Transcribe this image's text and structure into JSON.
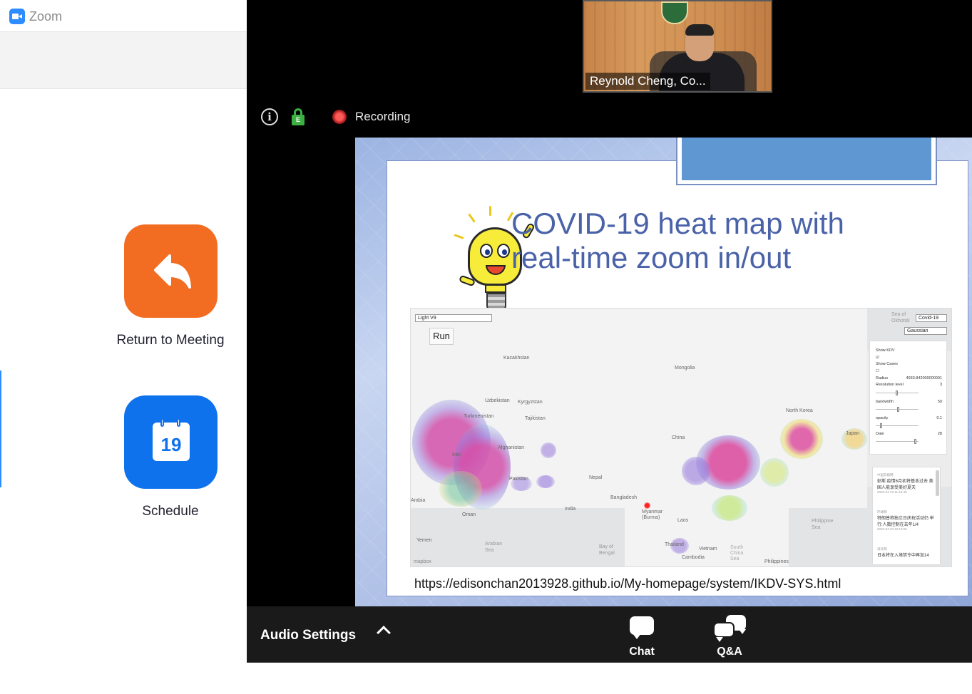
{
  "zoom_app": {
    "title": "Zoom",
    "home": {
      "return_label": "Return to Meeting",
      "schedule_label": "Schedule",
      "calendar_day": "19",
      "return_color": "#f26d21",
      "schedule_color": "#0e72ed"
    }
  },
  "meeting": {
    "participant": {
      "name": "Reynold Cheng, Co..."
    },
    "status": {
      "info_icon": "i",
      "encryption_badge": "E",
      "recording_label": "Recording"
    },
    "slide": {
      "title_line1": "COVID-19 heat map with",
      "title_line2": "real-time zoom in/out",
      "url": "https://edisonchan2013928.github.io/My-homepage/system/IKDV-SYS.html",
      "map": {
        "style_select": "Light V9",
        "run_button": "Run",
        "dataset_select": "Covid-19",
        "kernel_select": "Gaussian",
        "panel": {
          "show_kdv": "Show KDV",
          "show_cases": "Show Cases",
          "radius_label": "Radius",
          "radius_value": "4933.842000000001",
          "resolution_label": "Resolution level",
          "resolution_value": "3",
          "bandwidth_label": "bandwidth",
          "bandwidth_value": "50",
          "opacity_label": "opacity",
          "opacity_value": "0.1",
          "date_label": "Date",
          "date_value": "28"
        },
        "news": [
          {
            "source": "中国日报网",
            "headline": "彭斯:疫情6月初将基本过去 美国人能享受美好夏天",
            "time": "2020-04-23 11:16:45"
          },
          {
            "source": "环球网",
            "headline": "特朗普称独立日庆祝活动仍 举行:人数控制在去年1/4",
            "time": "2020-04-23 10:13:06"
          },
          {
            "source": "海外网",
            "headline": "日本将在入境禁令中再加14",
            "time": ""
          }
        ],
        "labels": {
          "kazakhstan": "Kazakhstan",
          "mongolia": "Mongolia",
          "uzbekistan": "Uzbekistan",
          "kyrgyzstan": "Kyrgyzstan",
          "tajikistan": "Tajikistan",
          "turkmenistan": "Turkmenistan",
          "afghanistan": "Afghanistan",
          "iran": "Iran",
          "pakistan": "Pakistan",
          "nepal": "Nepal",
          "china": "China",
          "india": "India",
          "bangladesh": "Bangladesh",
          "myanmar": "Myanmar (Burma)",
          "laos": "Laos",
          "thailand": "Thailand",
          "vietnam": "Vietnam",
          "cambodia": "Cambodia",
          "oman": "Oman",
          "arabia": "Arabia",
          "yemen": "Yemen",
          "arabian_sea": "Arabian Sea",
          "bay_of_bengal": "Bay of Bengal",
          "north_korea": "North Korea",
          "japan": "Japan",
          "philippine_sea": "Philippine Sea",
          "philippines": "Philippines",
          "sea_of_okhotsk": "Sea of Okhotsk",
          "mapbox": "mapbox",
          "south_china_sea": "South China Sea"
        }
      }
    }
  },
  "toolbar": {
    "audio_settings": "Audio Settings",
    "chat_label": "Chat",
    "qa_label": "Q&A"
  }
}
